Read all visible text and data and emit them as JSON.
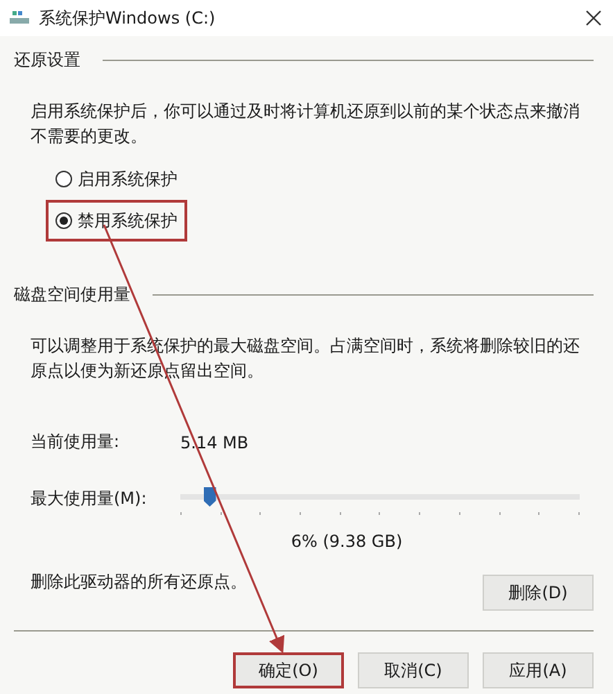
{
  "window": {
    "title": "系统保护Windows (C:)"
  },
  "restore_settings": {
    "heading": "还原设置",
    "description": "启用系统保护后，你可以通过及时将计算机还原到以前的某个状态点来撤消不需要的更改。",
    "options": [
      {
        "label": "启用系统保护",
        "selected": false,
        "highlighted": false
      },
      {
        "label": "禁用系统保护",
        "selected": true,
        "highlighted": true
      }
    ]
  },
  "disk_usage": {
    "heading": "磁盘空间使用量",
    "description": "可以调整用于系统保护的最大磁盘空间。占满空间时，系统将删除较旧的还原点以便为新还原点留出空间。",
    "current_label": "当前使用量:",
    "current_value": "5.14 MB",
    "max_label": "最大使用量(M):",
    "slider": {
      "level": 0.06
    },
    "slider_reading": "6% (9.38 GB)",
    "delete_text": "删除此驱动器的所有还原点。",
    "delete_button": "删除(D)"
  },
  "buttons": [
    {
      "label": "确定(O)",
      "highlighted": true
    },
    {
      "label": "取消(C)",
      "highlighted": false
    },
    {
      "label": "应用(A)",
      "highlighted": false
    }
  ]
}
